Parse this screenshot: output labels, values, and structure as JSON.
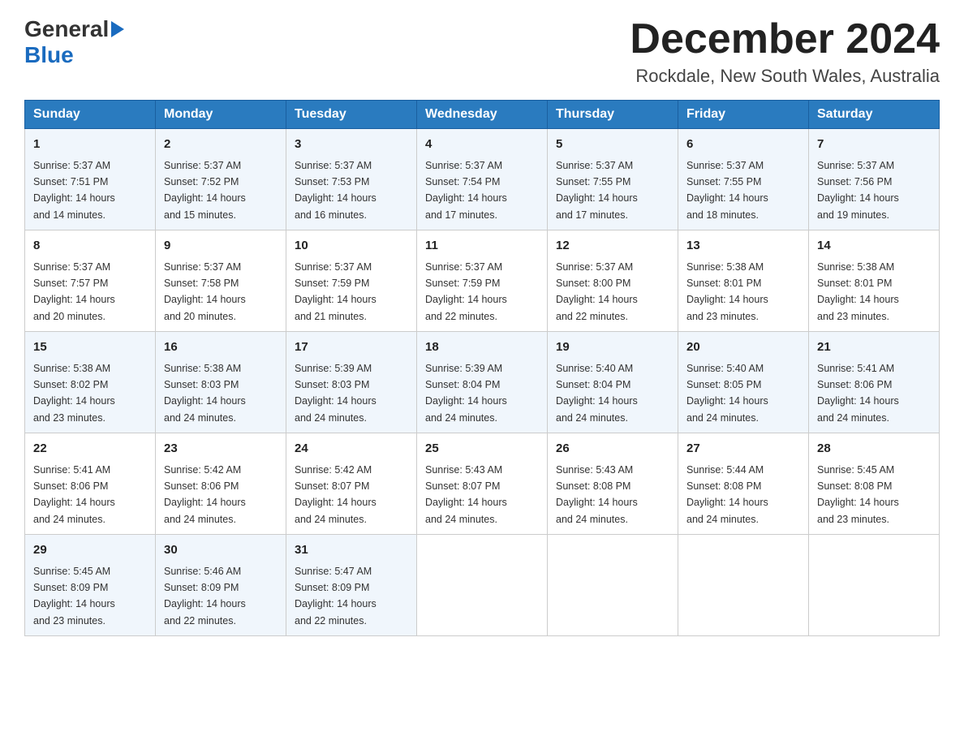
{
  "header": {
    "logo_general": "General",
    "logo_blue": "Blue",
    "month_title": "December 2024",
    "location": "Rockdale, New South Wales, Australia"
  },
  "days_of_week": [
    "Sunday",
    "Monday",
    "Tuesday",
    "Wednesday",
    "Thursday",
    "Friday",
    "Saturday"
  ],
  "weeks": [
    [
      {
        "day": "1",
        "sunrise": "5:37 AM",
        "sunset": "7:51 PM",
        "daylight": "14 hours and 14 minutes."
      },
      {
        "day": "2",
        "sunrise": "5:37 AM",
        "sunset": "7:52 PM",
        "daylight": "14 hours and 15 minutes."
      },
      {
        "day": "3",
        "sunrise": "5:37 AM",
        "sunset": "7:53 PM",
        "daylight": "14 hours and 16 minutes."
      },
      {
        "day": "4",
        "sunrise": "5:37 AM",
        "sunset": "7:54 PM",
        "daylight": "14 hours and 17 minutes."
      },
      {
        "day": "5",
        "sunrise": "5:37 AM",
        "sunset": "7:55 PM",
        "daylight": "14 hours and 17 minutes."
      },
      {
        "day": "6",
        "sunrise": "5:37 AM",
        "sunset": "7:55 PM",
        "daylight": "14 hours and 18 minutes."
      },
      {
        "day": "7",
        "sunrise": "5:37 AM",
        "sunset": "7:56 PM",
        "daylight": "14 hours and 19 minutes."
      }
    ],
    [
      {
        "day": "8",
        "sunrise": "5:37 AM",
        "sunset": "7:57 PM",
        "daylight": "14 hours and 20 minutes."
      },
      {
        "day": "9",
        "sunrise": "5:37 AM",
        "sunset": "7:58 PM",
        "daylight": "14 hours and 20 minutes."
      },
      {
        "day": "10",
        "sunrise": "5:37 AM",
        "sunset": "7:59 PM",
        "daylight": "14 hours and 21 minutes."
      },
      {
        "day": "11",
        "sunrise": "5:37 AM",
        "sunset": "7:59 PM",
        "daylight": "14 hours and 22 minutes."
      },
      {
        "day": "12",
        "sunrise": "5:37 AM",
        "sunset": "8:00 PM",
        "daylight": "14 hours and 22 minutes."
      },
      {
        "day": "13",
        "sunrise": "5:38 AM",
        "sunset": "8:01 PM",
        "daylight": "14 hours and 23 minutes."
      },
      {
        "day": "14",
        "sunrise": "5:38 AM",
        "sunset": "8:01 PM",
        "daylight": "14 hours and 23 minutes."
      }
    ],
    [
      {
        "day": "15",
        "sunrise": "5:38 AM",
        "sunset": "8:02 PM",
        "daylight": "14 hours and 23 minutes."
      },
      {
        "day": "16",
        "sunrise": "5:38 AM",
        "sunset": "8:03 PM",
        "daylight": "14 hours and 24 minutes."
      },
      {
        "day": "17",
        "sunrise": "5:39 AM",
        "sunset": "8:03 PM",
        "daylight": "14 hours and 24 minutes."
      },
      {
        "day": "18",
        "sunrise": "5:39 AM",
        "sunset": "8:04 PM",
        "daylight": "14 hours and 24 minutes."
      },
      {
        "day": "19",
        "sunrise": "5:40 AM",
        "sunset": "8:04 PM",
        "daylight": "14 hours and 24 minutes."
      },
      {
        "day": "20",
        "sunrise": "5:40 AM",
        "sunset": "8:05 PM",
        "daylight": "14 hours and 24 minutes."
      },
      {
        "day": "21",
        "sunrise": "5:41 AM",
        "sunset": "8:06 PM",
        "daylight": "14 hours and 24 minutes."
      }
    ],
    [
      {
        "day": "22",
        "sunrise": "5:41 AM",
        "sunset": "8:06 PM",
        "daylight": "14 hours and 24 minutes."
      },
      {
        "day": "23",
        "sunrise": "5:42 AM",
        "sunset": "8:06 PM",
        "daylight": "14 hours and 24 minutes."
      },
      {
        "day": "24",
        "sunrise": "5:42 AM",
        "sunset": "8:07 PM",
        "daylight": "14 hours and 24 minutes."
      },
      {
        "day": "25",
        "sunrise": "5:43 AM",
        "sunset": "8:07 PM",
        "daylight": "14 hours and 24 minutes."
      },
      {
        "day": "26",
        "sunrise": "5:43 AM",
        "sunset": "8:08 PM",
        "daylight": "14 hours and 24 minutes."
      },
      {
        "day": "27",
        "sunrise": "5:44 AM",
        "sunset": "8:08 PM",
        "daylight": "14 hours and 24 minutes."
      },
      {
        "day": "28",
        "sunrise": "5:45 AM",
        "sunset": "8:08 PM",
        "daylight": "14 hours and 23 minutes."
      }
    ],
    [
      {
        "day": "29",
        "sunrise": "5:45 AM",
        "sunset": "8:09 PM",
        "daylight": "14 hours and 23 minutes."
      },
      {
        "day": "30",
        "sunrise": "5:46 AM",
        "sunset": "8:09 PM",
        "daylight": "14 hours and 22 minutes."
      },
      {
        "day": "31",
        "sunrise": "5:47 AM",
        "sunset": "8:09 PM",
        "daylight": "14 hours and 22 minutes."
      },
      null,
      null,
      null,
      null
    ]
  ],
  "labels": {
    "sunrise": "Sunrise:",
    "sunset": "Sunset:",
    "daylight": "Daylight:"
  }
}
